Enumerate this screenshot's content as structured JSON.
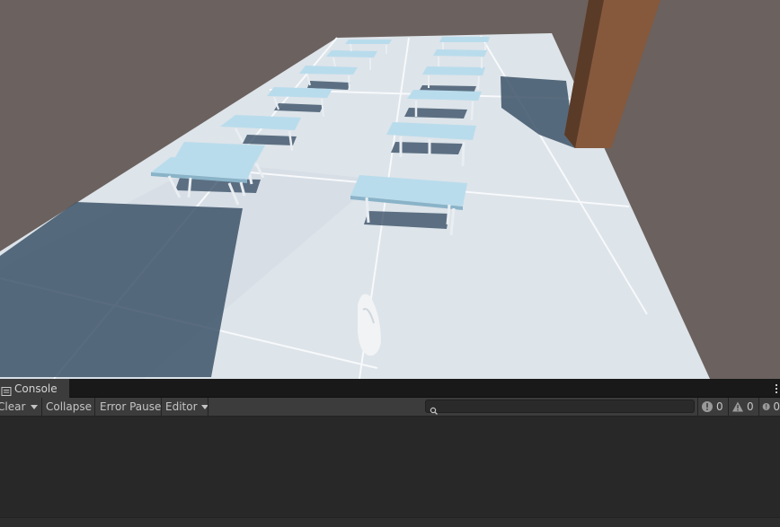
{
  "console": {
    "tab_label": "Console",
    "toolbar": {
      "clear": "Clear",
      "collapse": "Collapse",
      "error_pause": "Error Pause",
      "editor": "Editor"
    },
    "search": {
      "value": "",
      "placeholder": ""
    },
    "counts": {
      "log": "0",
      "warning": "0",
      "error": "0"
    }
  },
  "icons": [
    "console-icon",
    "dropdown-caret-icon",
    "search-icon",
    "info-icon",
    "warning-icon",
    "error-icon",
    "more-options-icon"
  ],
  "colors": {
    "ground_backdrop": "#6b615e",
    "floor": "#dde4ea",
    "table_top": "#b9dcec",
    "pillar": "#86593d",
    "console_bg": "#282828",
    "toolbar_bg": "#3c3c3c"
  }
}
